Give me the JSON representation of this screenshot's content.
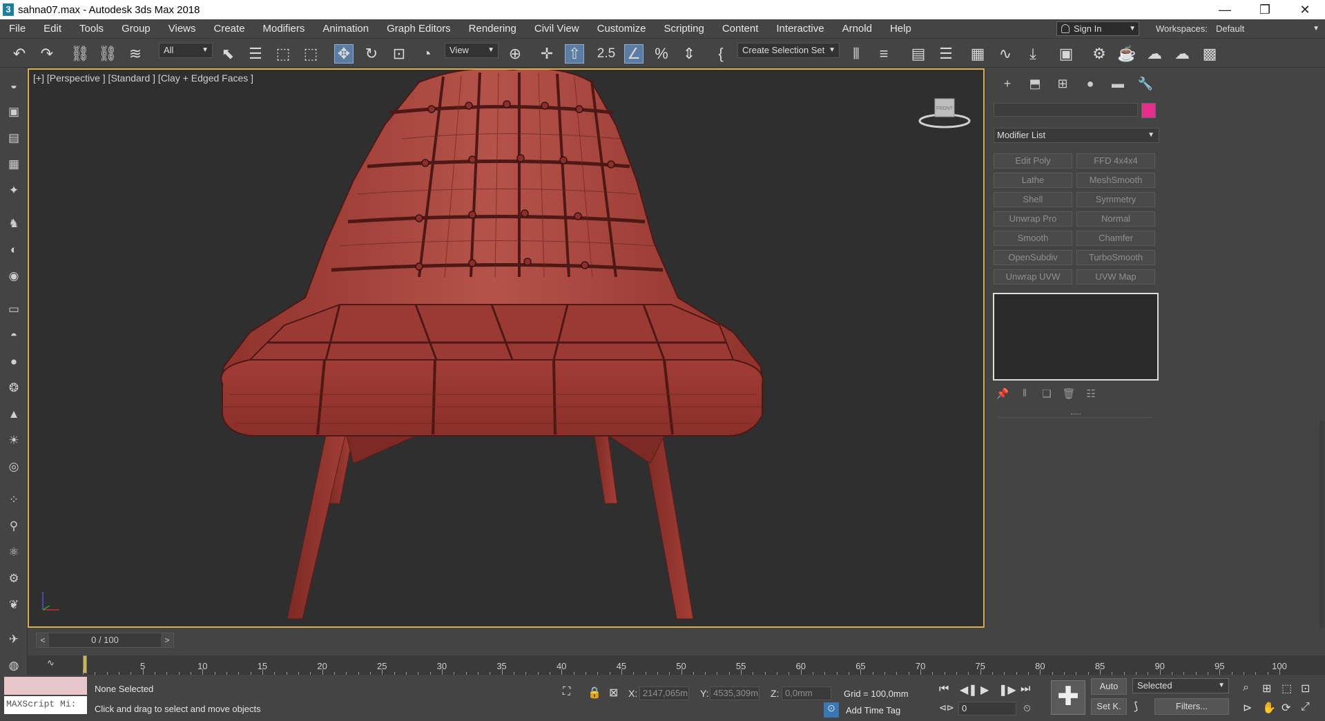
{
  "window": {
    "title": "sahna07.max - Autodesk 3ds Max 2018",
    "app_icon": "3",
    "controls": {
      "minimize": "—",
      "maximize": "❐",
      "close": "✕"
    }
  },
  "menu": [
    "File",
    "Edit",
    "Tools",
    "Group",
    "Views",
    "Create",
    "Modifiers",
    "Animation",
    "Graph Editors",
    "Rendering",
    "Civil View",
    "Customize",
    "Scripting",
    "Content",
    "Interactive",
    "Arnold",
    "Help"
  ],
  "account": {
    "sign_in": "Sign In",
    "workspaces_label": "Workspaces:",
    "workspace": "Default"
  },
  "toolbar": {
    "selection_filter": "All",
    "ref_coord": "View",
    "snap_value": "2.5",
    "selection_set": "Create Selection Set"
  },
  "viewport": {
    "label": "[+] [Perspective ] [Standard ] [Clay + Edged Faces ]",
    "viewcube_label": "FRONT"
  },
  "command_panel": {
    "object_color": "#e32f8b",
    "modifier_list": "Modifier List",
    "modifier_buttons": [
      "Edit Poly",
      "FFD 4x4x4",
      "Lathe",
      "MeshSmooth",
      "Shell",
      "Symmetry",
      "Unwrap Pro",
      "Normal",
      "Smooth",
      "Chamfer",
      "OpenSubdiv",
      "TurboSmooth",
      "Unwrap UVW",
      "UVW Map"
    ]
  },
  "timeline": {
    "frame": "0 / 100",
    "prev": "<",
    "next": ">",
    "ticks": [
      "5",
      "10",
      "15",
      "20",
      "25",
      "30",
      "35",
      "40",
      "45",
      "50",
      "55",
      "60",
      "65",
      "70",
      "75",
      "80",
      "85",
      "90",
      "95",
      "100"
    ]
  },
  "status": {
    "maxscript": "MAXScript Mi:",
    "selection": "None Selected",
    "prompt": "Click and drag to select and move objects",
    "x_label": "X:",
    "x": "2147,065m",
    "y_label": "Y:",
    "y": "4535,309m",
    "z_label": "Z:",
    "z": "0,0mm",
    "grid": "Grid = 100,0mm",
    "add_time_tag": "Add Time Tag",
    "auto": "Auto",
    "selected": "Selected",
    "set_key": "Set K.",
    "filters": "Filters...",
    "current_frame": "0"
  }
}
